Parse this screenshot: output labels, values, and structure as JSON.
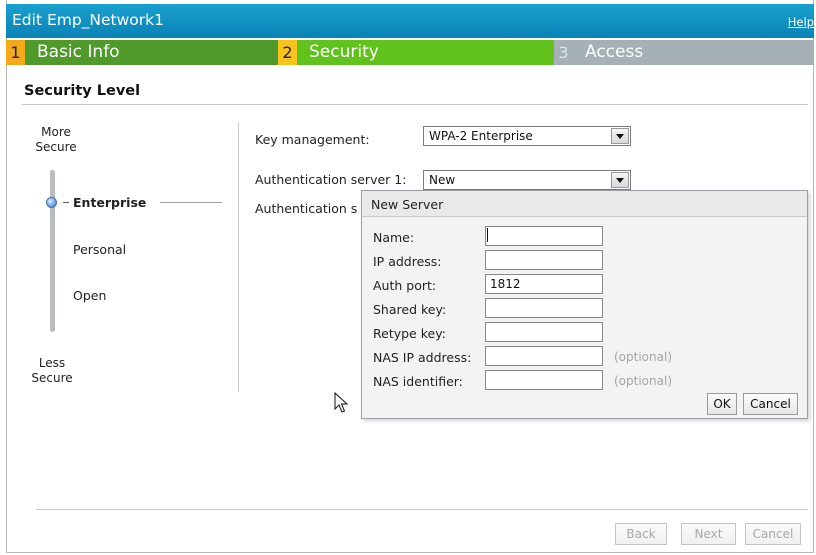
{
  "window": {
    "title": "Edit Emp_Network1",
    "help_label": "Help"
  },
  "steps": [
    {
      "number": "1",
      "label": "Basic Info"
    },
    {
      "number": "2",
      "label": "Security"
    },
    {
      "number": "3",
      "label": "Access"
    }
  ],
  "section": {
    "title": "Security Level"
  },
  "security_slider": {
    "more_secure_label": "More\nSecure",
    "less_secure_label": "Less\nSecure",
    "options": [
      "Enterprise",
      "Personal",
      "Open"
    ],
    "selected": "Enterprise"
  },
  "form": {
    "key_management_label": "Key management:",
    "key_management_value": "WPA-2 Enterprise",
    "auth_server1_label": "Authentication server 1:",
    "auth_server1_value": "New",
    "auth_server2_label_partial": "Authentication s"
  },
  "new_server_dialog": {
    "title": "New Server",
    "fields": {
      "name": {
        "label": "Name:",
        "value": ""
      },
      "ip_address": {
        "label": "IP address:",
        "value": ""
      },
      "auth_port": {
        "label": "Auth port:",
        "value": "1812"
      },
      "shared_key": {
        "label": "Shared key:",
        "value": ""
      },
      "retype_key": {
        "label": "Retype key:",
        "value": ""
      },
      "nas_ip_address": {
        "label": "NAS IP address:",
        "value": "",
        "hint": "(optional)"
      },
      "nas_identifier": {
        "label": "NAS identifier:",
        "value": "",
        "hint": "(optional)"
      }
    },
    "ok_label": "OK",
    "cancel_label": "Cancel"
  },
  "footer": {
    "back_label": "Back",
    "next_label": "Next",
    "cancel_label": "Cancel"
  },
  "colors": {
    "titlebar": "#0a82b6",
    "step1_bg": "#4f9a2a",
    "step2_bg": "#62c21d",
    "step3_bg": "#a5b0b7",
    "step_number_bg": "#f4a91b"
  }
}
